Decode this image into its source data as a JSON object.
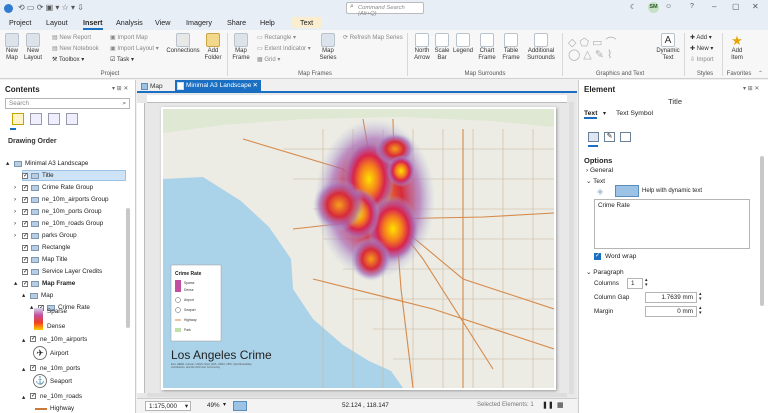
{
  "title_bar": {
    "command_search_placeholder": "Command Search (Alt+Q)",
    "user_initials": "SM",
    "help": "?"
  },
  "tabs": [
    "Project",
    "Layout",
    "Insert",
    "Analysis",
    "View",
    "Imagery",
    "Share",
    "Help",
    "Text"
  ],
  "active_tab": "Insert",
  "ribbon": {
    "project": {
      "items": [
        "New Map",
        "New Layout"
      ],
      "small": [
        "New Report",
        "New Notebook",
        "Toolbox"
      ],
      "small2": [
        "Import Map",
        "Import Layout",
        "Task"
      ],
      "connections": "Connections",
      "add_folder": "Add Folder",
      "label": "Project"
    },
    "map_frames": {
      "items": [
        "Map Frame",
        "Map Series"
      ],
      "small": [
        "Rectangle",
        "Extent Indicator",
        "Grid"
      ],
      "refresh": "Refresh Map Series",
      "label": "Map Frames"
    },
    "map_surrounds": {
      "items": [
        "North Arrow",
        "Scale Bar",
        "Legend",
        "Chart Frame",
        "Table Frame",
        "Additional Surrounds"
      ],
      "label": "Map Surrounds"
    },
    "graphics_text": {
      "dynamic_text": "Dynamic Text",
      "label": "Graphics and Text"
    },
    "styles": {
      "items": [
        "Add",
        "New",
        "Import"
      ],
      "label": "Styles"
    },
    "favorites": {
      "add_item": "Add Item",
      "label": "Favorites"
    }
  },
  "contents": {
    "title": "Contents",
    "search_placeholder": "Search",
    "drawing_order": "Drawing Order",
    "items": [
      {
        "label": "Minimal A3 Landscape",
        "level": 0,
        "expand": "▴",
        "check": false
      },
      {
        "label": "Title",
        "level": 1,
        "check": true,
        "selected": true
      },
      {
        "label": "Crime Rate Group",
        "level": 1,
        "expand": "›",
        "check": true
      },
      {
        "label": "ne_10m_airports Group",
        "level": 1,
        "expand": "›",
        "check": true
      },
      {
        "label": "ne_10m_ports Group",
        "level": 1,
        "expand": "›",
        "check": true
      },
      {
        "label": "ne_10m_roads Group",
        "level": 1,
        "expand": "›",
        "check": true
      },
      {
        "label": "parks Group",
        "level": 1,
        "expand": "›",
        "check": true
      },
      {
        "label": "Rectangle",
        "level": 1,
        "check": true
      },
      {
        "label": "Map Title",
        "level": 1,
        "check": true
      },
      {
        "label": "Service Layer Credits",
        "level": 1,
        "check": true
      },
      {
        "label": "Map Frame",
        "level": 1,
        "expand": "▴",
        "check": true,
        "bold": true
      },
      {
        "label": "Map",
        "level": 2,
        "expand": "▴",
        "check": false
      },
      {
        "label": "Crime Rate",
        "level": 3,
        "expand": "▴",
        "check": true
      }
    ],
    "crime_legend": [
      "Sparse",
      "Dense"
    ],
    "airports_label": "ne_10m_airports",
    "airport": "Airport",
    "ports_label": "ne_10m_ports",
    "seaport": "Seaport",
    "roads_label": "ne_10m_roads",
    "highway": "Highway"
  },
  "view_tabs": [
    {
      "label": "Map",
      "active": false
    },
    {
      "label": "Minimal A3 Landscape",
      "active": true
    }
  ],
  "layout": {
    "map_title": "Los Angeles Crime",
    "legend_title": "Crime Rate",
    "legend_items": [
      "Sparse",
      "Dense",
      "Airport",
      "Seaport",
      "Highway",
      "Park"
    ],
    "credits": "Esri, HERE, Garmin, USGS, NGA, EPA, USDA, NPS, OpenStreetMap contributors, and the GIS User Community"
  },
  "status": {
    "scale": "1:175,000",
    "zoom": "49%",
    "coords": "52.124 , 118.147",
    "selected": "Selected Elements: 1"
  },
  "element_pane": {
    "title": "Element",
    "subtitle": "Title",
    "tabs": [
      "Text",
      "Text Symbol"
    ],
    "options": "Options",
    "general": "General",
    "text_section": "Text",
    "help_dynamic": "Help with dynamic text",
    "text_value": "Crime Rate",
    "word_wrap": "Word wrap",
    "paragraph": "Paragraph",
    "columns_label": "Columns",
    "columns_value": "1",
    "column_gap_label": "Column Gap",
    "column_gap_value": "1.7639 mm",
    "margin_label": "Margin",
    "margin_value": "0 mm"
  }
}
